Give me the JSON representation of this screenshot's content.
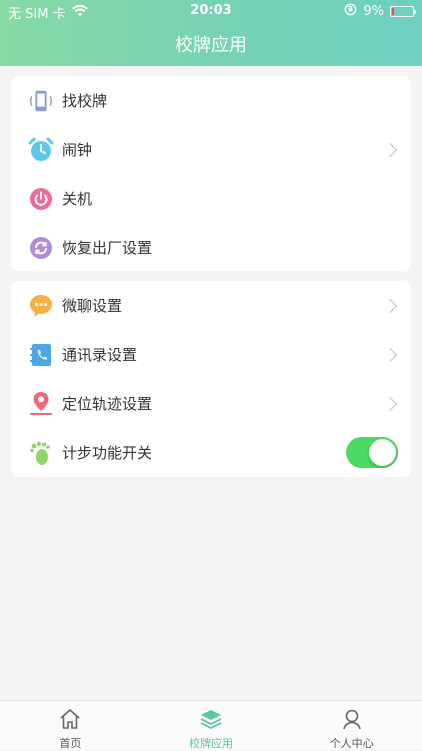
{
  "status_bar": {
    "carrier": "无 SIM 卡",
    "time": "20:03",
    "battery": "9%",
    "battery_level": 0.09
  },
  "header": {
    "title": "校牌应用"
  },
  "group1": {
    "items": [
      {
        "label": "找校牌",
        "icon": "phone-vibrate-icon"
      },
      {
        "label": "闹钟",
        "icon": "alarm-clock-icon"
      },
      {
        "label": "关机",
        "icon": "power-icon"
      },
      {
        "label": "恢复出厂设置",
        "icon": "reset-icon"
      }
    ]
  },
  "group2": {
    "items": [
      {
        "label": "微聊设置",
        "icon": "chat-bubble-icon"
      },
      {
        "label": "通讯录设置",
        "icon": "contacts-book-icon"
      },
      {
        "label": "定位轨迹设置",
        "icon": "location-pin-icon"
      },
      {
        "label": "计步功能开关",
        "icon": "footprint-icon",
        "toggle_on": true
      }
    ]
  },
  "tabbar": {
    "tabs": [
      {
        "label": "首页",
        "icon": "home-icon"
      },
      {
        "label": "校牌应用",
        "icon": "layers-icon",
        "active": true
      },
      {
        "label": "个人中心",
        "icon": "person-icon"
      }
    ]
  },
  "colors": {
    "accent": "#59c5a5",
    "toggle_on": "#4cd964"
  }
}
